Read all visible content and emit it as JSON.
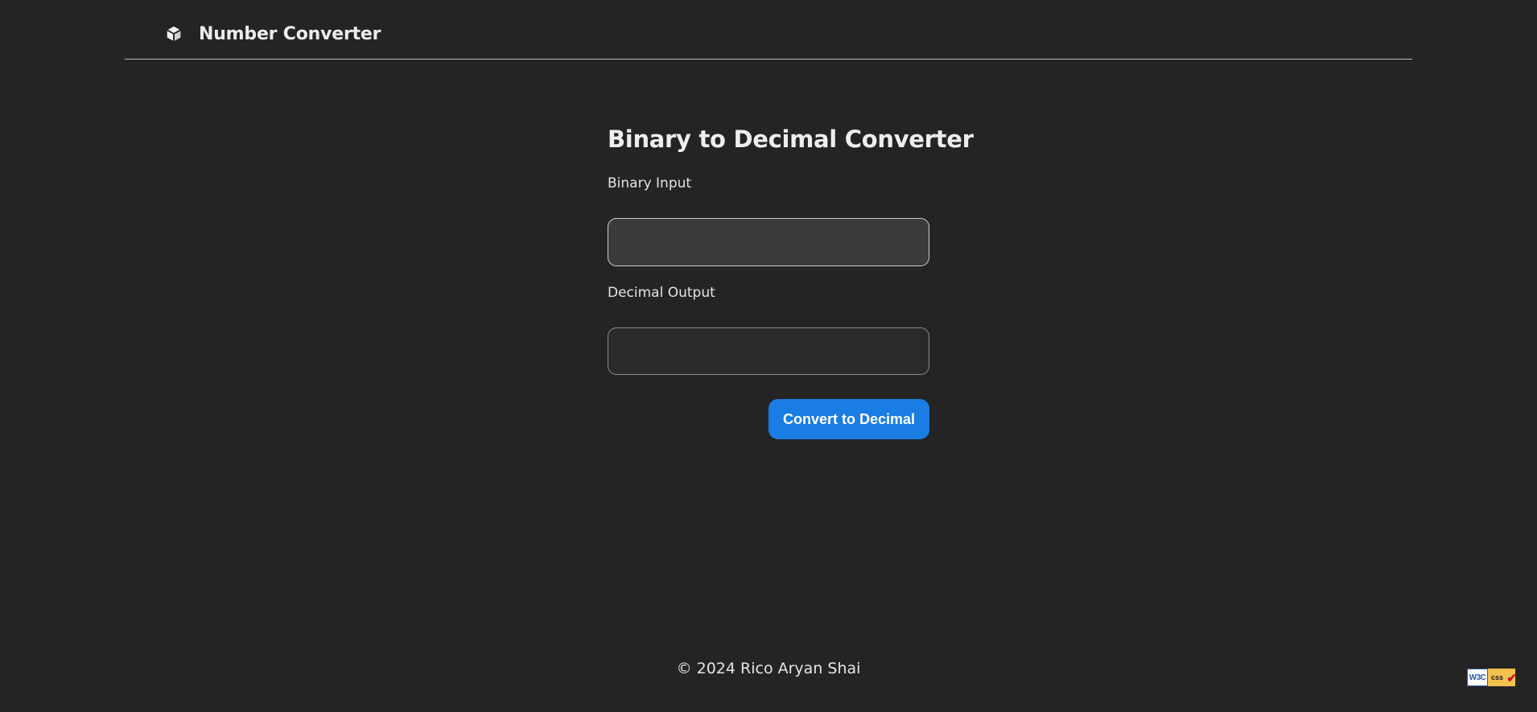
{
  "header": {
    "brand_icon": "cube-icon",
    "title": "Number Converter"
  },
  "converter": {
    "heading": "Binary to Decimal Converter",
    "binary_label": "Binary Input",
    "binary_value": "",
    "decimal_label": "Decimal Output",
    "decimal_value": "",
    "button_label": "Convert to Decimal"
  },
  "footer": {
    "text": "© 2024 Rico Aryan Shai"
  },
  "badge": {
    "left_text": "W3C",
    "right_text": "css",
    "check": "✔"
  },
  "colors": {
    "background": "#242424",
    "accent": "#1a7de3",
    "text": "#e8e8e8"
  }
}
